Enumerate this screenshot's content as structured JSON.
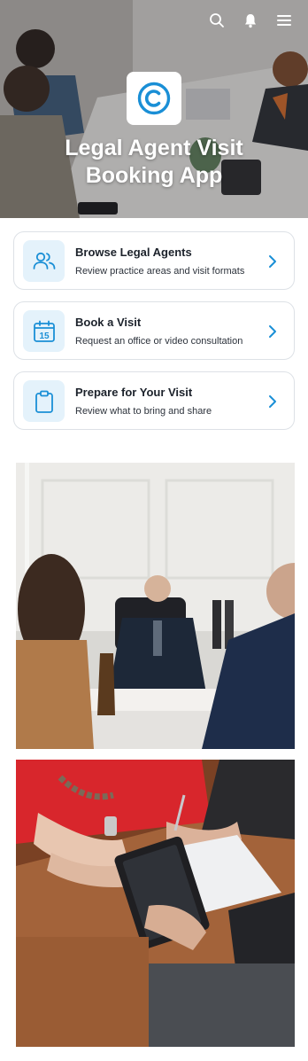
{
  "colors": {
    "accent": "#1a8fd6",
    "icon_bg": "#e4f2fb",
    "card_border": "#dde1e6"
  },
  "header": {
    "icons": [
      "search-icon",
      "notification-bell-icon",
      "menu-icon"
    ],
    "logo_icon": "copyright-c-logo-icon",
    "title_line1": "Legal Agent Visit",
    "title_line2": "Booking App"
  },
  "cards": [
    {
      "icon": "people-icon",
      "title": "Browse Legal Agents",
      "subtitle": "Review practice areas and visit formats"
    },
    {
      "icon": "calendar-15-icon",
      "calendar_day": "15",
      "title": "Book a Visit",
      "subtitle": "Request an office or video consultation"
    },
    {
      "icon": "clipboard-icon",
      "title": "Prepare for Your Visit",
      "subtitle": "Review what to bring and share"
    }
  ]
}
